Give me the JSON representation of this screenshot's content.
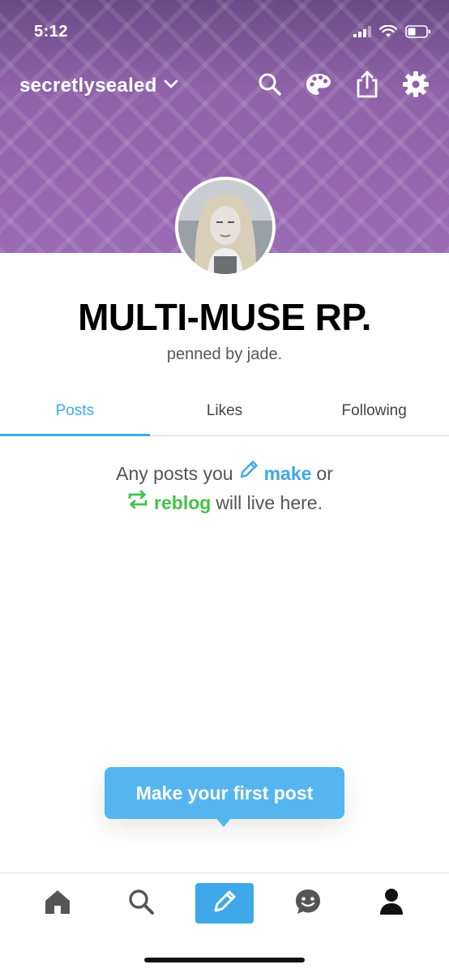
{
  "status_bar": {
    "time": "5:12",
    "icons": [
      "signal-icon",
      "wifi-icon",
      "battery-icon"
    ]
  },
  "header": {
    "blog_name": "secretlysealed",
    "background_color": "#8f5fa8",
    "actions": [
      "search-icon",
      "palette-icon",
      "share-icon",
      "gear-icon"
    ]
  },
  "profile": {
    "title": "MULTI-MUSE RP.",
    "description": "penned by jade."
  },
  "tabs": [
    {
      "label": "Posts",
      "active": true
    },
    {
      "label": "Likes",
      "active": false
    },
    {
      "label": "Following",
      "active": false
    }
  ],
  "empty_state": {
    "prefix": "Any posts you",
    "make": "make",
    "or": "or",
    "reblog": "reblog",
    "suffix": "will live here."
  },
  "cta": {
    "label": "Make your first post"
  },
  "bottom_nav": {
    "items": [
      "home-icon",
      "search-icon",
      "compose-icon",
      "activity-face-icon",
      "account-icon"
    ],
    "active": "account-icon"
  },
  "colors": {
    "accent": "#3fa8ea",
    "reblog": "#46c049",
    "cta": "#55b6ef"
  }
}
